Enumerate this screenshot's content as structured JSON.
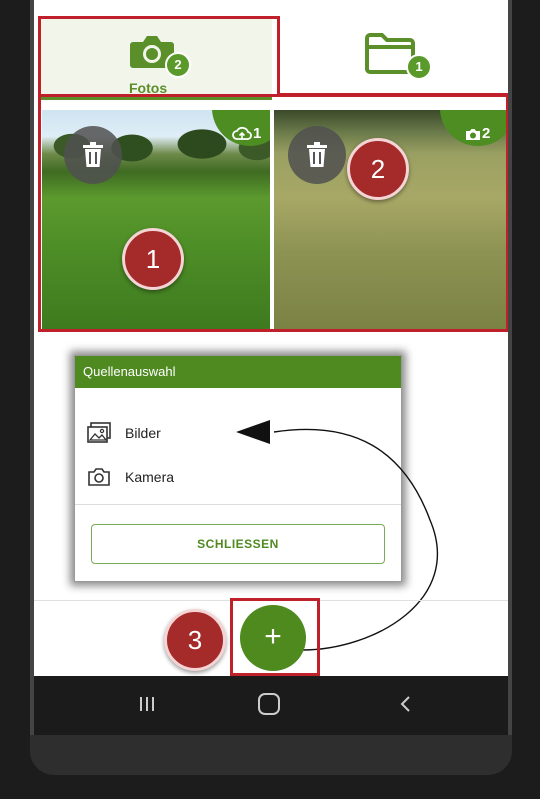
{
  "tabs": [
    {
      "label": "Fotos",
      "badge": "2",
      "icon": "camera-icon",
      "active": true
    },
    {
      "label": "",
      "badge": "1",
      "icon": "folder-icon",
      "active": false
    }
  ],
  "photos": [
    {
      "tag": "1",
      "tag_icon": "cloud-upload-icon",
      "step": "1"
    },
    {
      "tag": "2",
      "tag_icon": "camera-icon",
      "step": "2"
    }
  ],
  "dialog": {
    "title": "Quellenauswahl",
    "options": [
      {
        "label": "Bilder",
        "icon": "image-icon"
      },
      {
        "label": "Kamera",
        "icon": "camera-icon"
      }
    ],
    "close_label": "SCHLIESSEN"
  },
  "fab": {
    "label": "+",
    "step": "3"
  },
  "colors": {
    "brand_green": "#4f8a20",
    "highlight_red": "#c0202a",
    "step_marker": "#a52a2a"
  }
}
